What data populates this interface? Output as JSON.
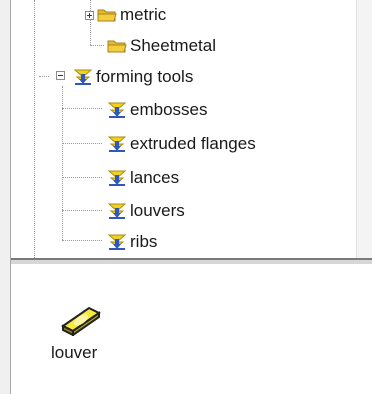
{
  "tree": {
    "nodes": [
      {
        "label": "metric",
        "icon": "folder-icon",
        "expander": "plus"
      },
      {
        "label": "Sheetmetal",
        "icon": "folder-icon",
        "expander": "none"
      },
      {
        "label": "forming tools",
        "icon": "forming-tool-icon",
        "expander": "minus"
      },
      {
        "label": "embosses",
        "icon": "forming-tool-icon",
        "expander": "none"
      },
      {
        "label": "extruded flanges",
        "icon": "forming-tool-icon",
        "expander": "none"
      },
      {
        "label": "lances",
        "icon": "forming-tool-icon",
        "expander": "none"
      },
      {
        "label": "louvers",
        "icon": "forming-tool-icon",
        "expander": "none"
      },
      {
        "label": "ribs",
        "icon": "forming-tool-icon",
        "expander": "none"
      }
    ]
  },
  "preview": {
    "items": [
      {
        "label": "louver",
        "icon": "louver-part-icon"
      }
    ]
  },
  "colors": {
    "folder": "#f2cd3c",
    "tool_yellow": "#f3d21c",
    "tool_blue": "#2f58b8"
  }
}
